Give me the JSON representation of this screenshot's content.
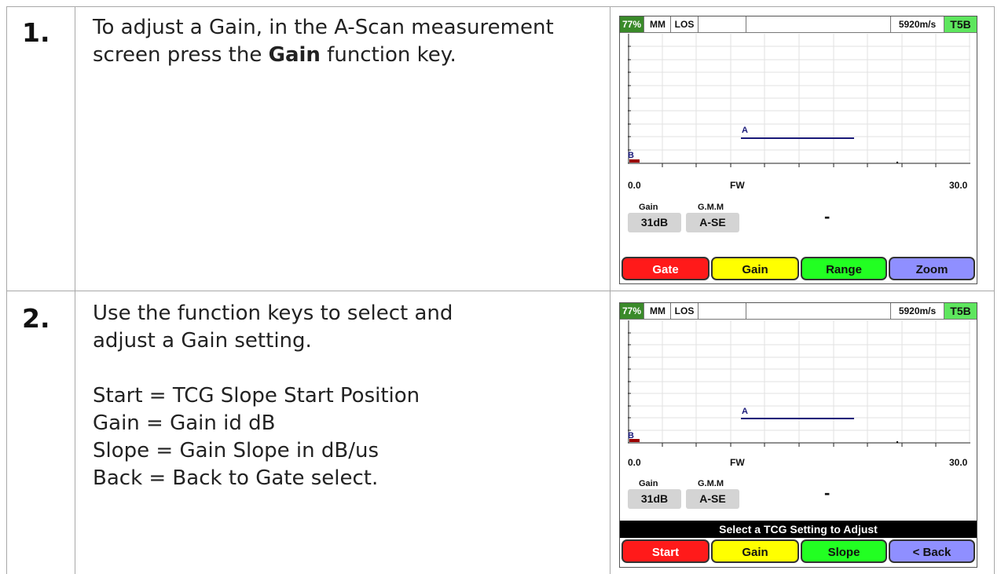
{
  "colors": {
    "battery": "#3a8a2a",
    "t5b": "#5ee65e",
    "gate_red": "#ff1a1a",
    "gain_yellow": "#ffff00",
    "range_green": "#22ff22",
    "zoom_purple": "#8f8fff",
    "gate_line_a": "#1a1a7a",
    "gate_b_bar": "#9b0000"
  },
  "steps": [
    {
      "number": "1.",
      "text_before": "To adjust a Gain, in the A-Scan measurement screen press the ",
      "text_bold": "Gain",
      "text_after": " function key.",
      "screen": {
        "battery": "77%",
        "mode": "MM",
        "los": "LOS",
        "velocity": "5920m/s",
        "probe": "T5B",
        "gate_a": "A",
        "gate_b": "B",
        "x_min": "0.0",
        "x_mid": "FW",
        "x_max": "30.0",
        "gain_label": "Gain",
        "gain_value": "31dB",
        "gmm_label": "G.M.M",
        "gmm_value": "A-SE",
        "reading": "-",
        "message": "",
        "keys": [
          "Gate",
          "Gain",
          "Range",
          "Zoom"
        ]
      }
    },
    {
      "number": "2.",
      "lines": [
        "Use the function keys to select and",
        "adjust a Gain setting.",
        "",
        "Start = TCG Slope Start Position",
        "Gain = Gain id dB",
        "Slope = Gain Slope in dB/us",
        "Back = Back to Gate select."
      ],
      "screen": {
        "battery": "77%",
        "mode": "MM",
        "los": "LOS",
        "velocity": "5920m/s",
        "probe": "T5B",
        "gate_a": "A",
        "gate_b": "B",
        "x_min": "0.0",
        "x_mid": "FW",
        "x_max": "30.0",
        "gain_label": "Gain",
        "gain_value": "31dB",
        "gmm_label": "G.M.M",
        "gmm_value": "A-SE",
        "reading": "-",
        "message": "Select a TCG Setting to Adjust",
        "keys": [
          "Start",
          "Gain",
          "Slope",
          "< Back"
        ]
      }
    }
  ]
}
